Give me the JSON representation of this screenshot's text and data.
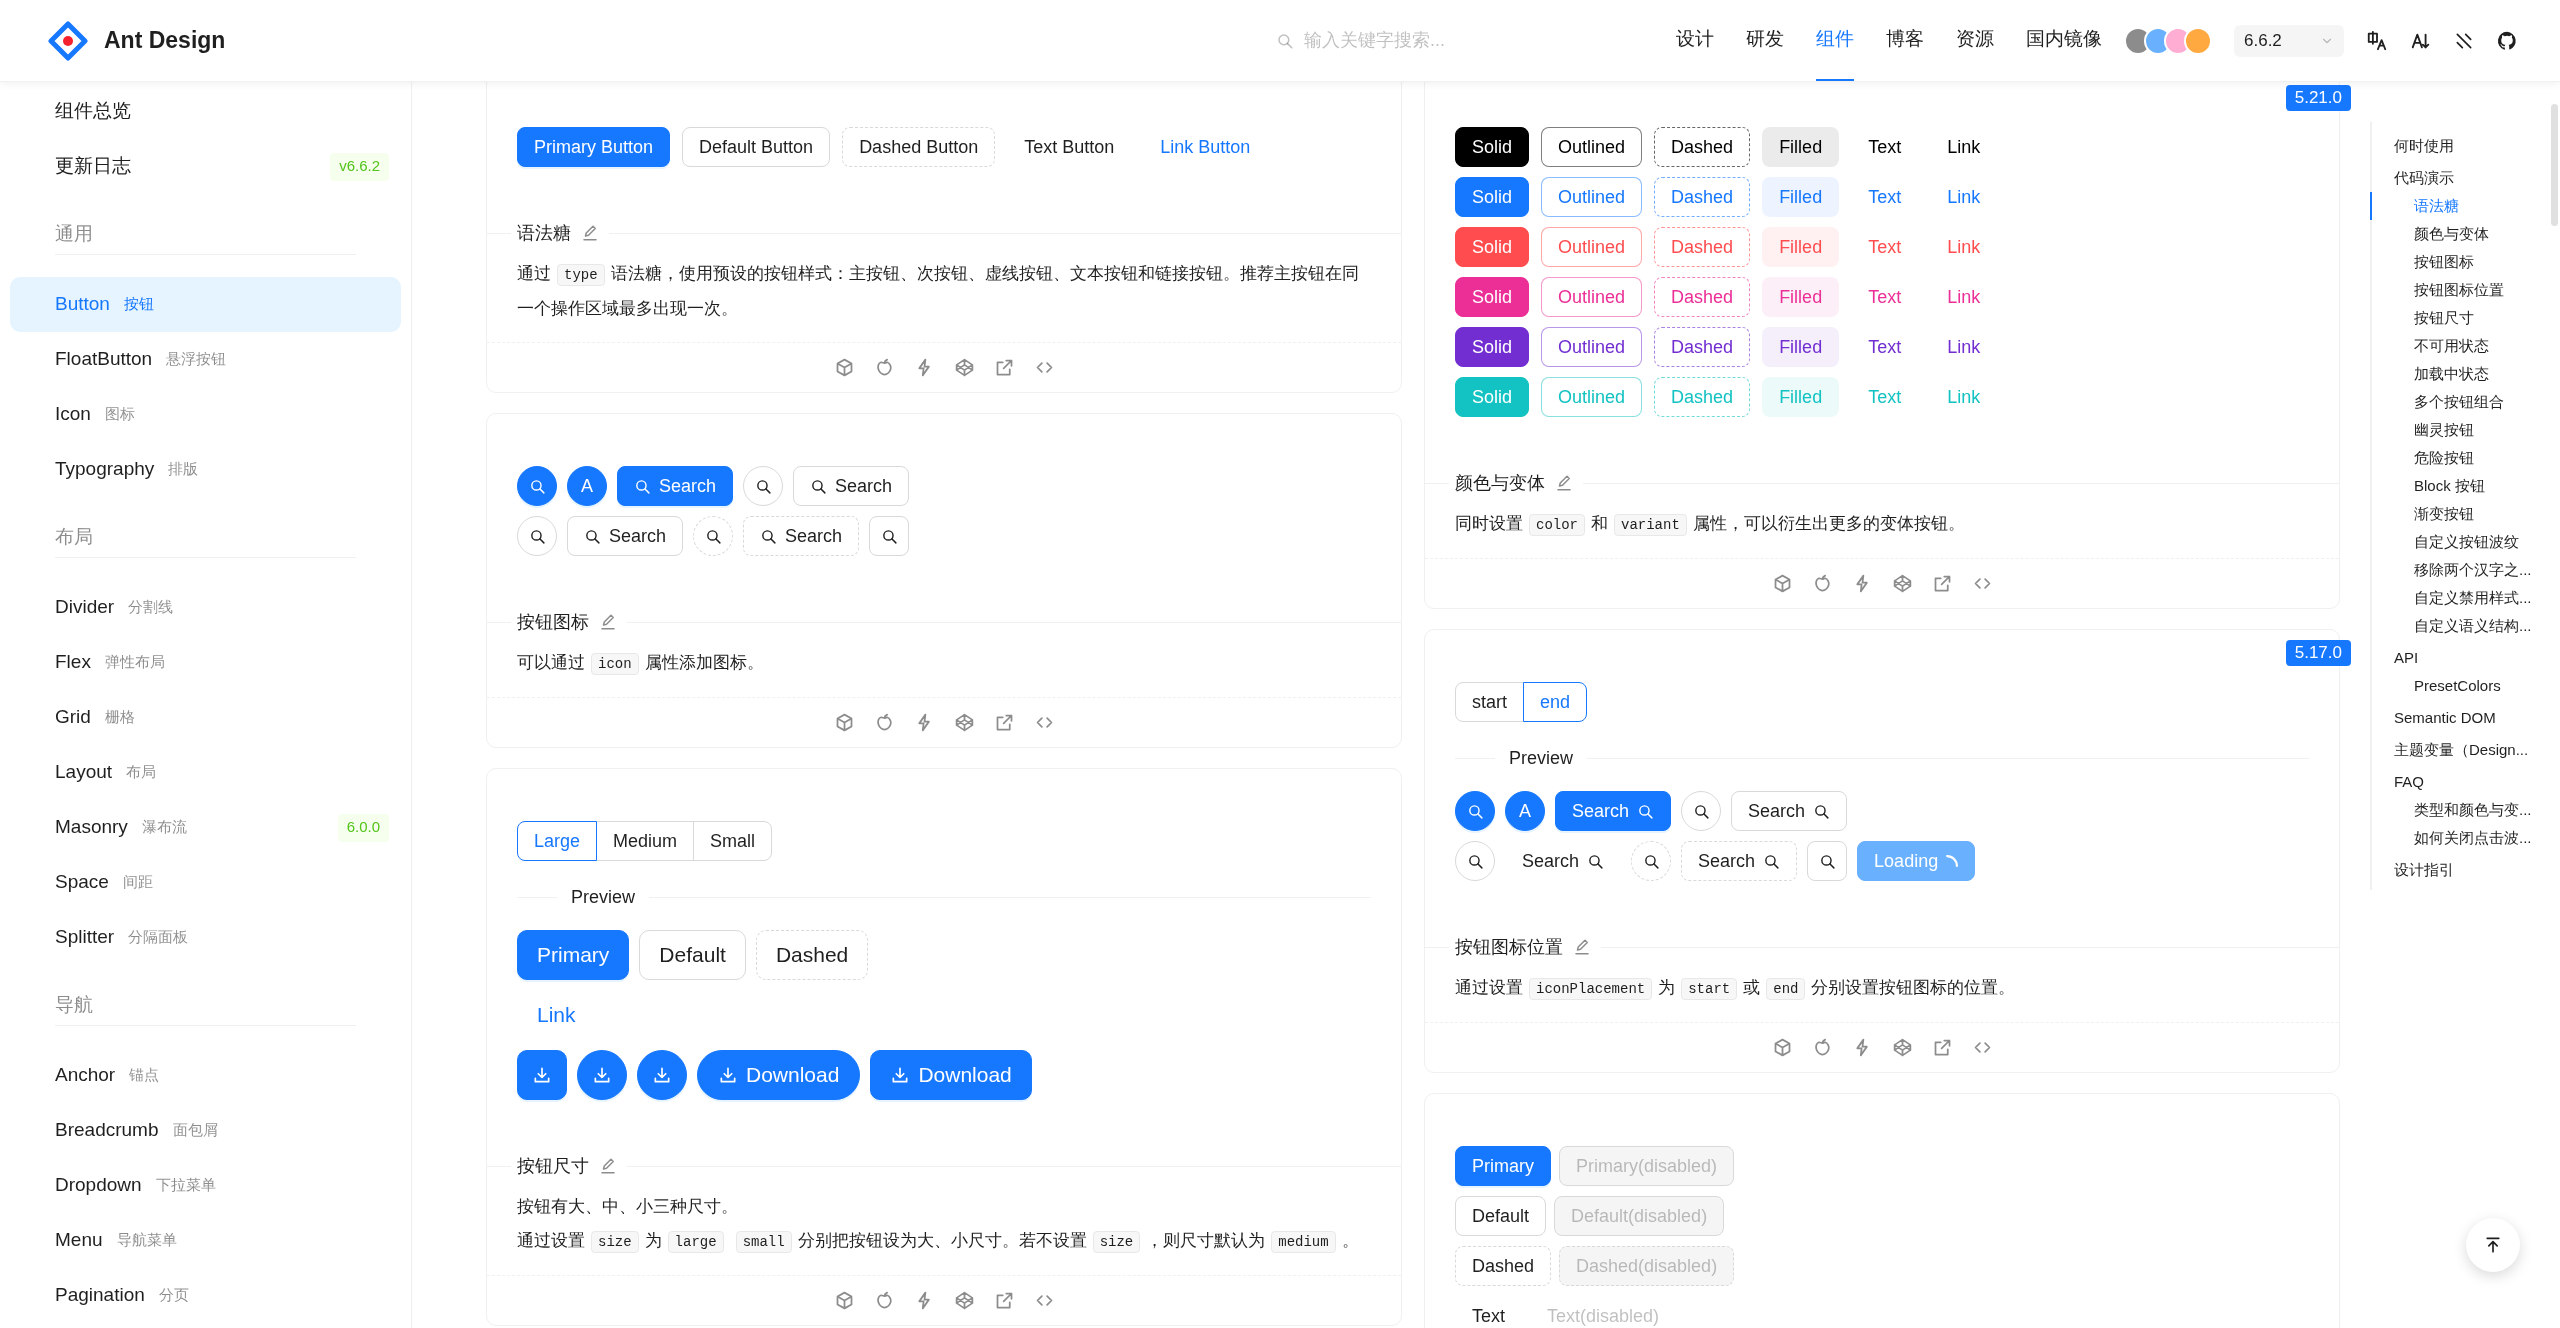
{
  "header": {
    "site_name": "Ant Design",
    "search": {
      "placeholder": "输入关键字搜索..."
    },
    "nav": [
      {
        "label": "设计",
        "selected": false
      },
      {
        "label": "研发",
        "selected": false
      },
      {
        "label": "组件",
        "selected": true
      },
      {
        "label": "博客",
        "selected": false
      },
      {
        "label": "资源",
        "selected": false
      },
      {
        "label": "国内镜像",
        "selected": false
      }
    ],
    "version": "6.6.2"
  },
  "sidebar": {
    "items": [
      {
        "label": "组件总览",
        "selected": false
      },
      {
        "label": "更新日志",
        "badge": "v6.6.2",
        "selected": false
      }
    ],
    "groups": [
      {
        "title": "通用",
        "items": [
          {
            "label": "Button",
            "subtitle": "按钮",
            "selected": true
          },
          {
            "label": "FloatButton",
            "subtitle": "悬浮按钮",
            "selected": false
          },
          {
            "label": "Icon",
            "subtitle": "图标",
            "selected": false
          },
          {
            "label": "Typography",
            "subtitle": "排版",
            "selected": false
          }
        ]
      },
      {
        "title": "布局",
        "items": [
          {
            "label": "Divider",
            "subtitle": "分割线",
            "selected": false
          },
          {
            "label": "Flex",
            "subtitle": "弹性布局",
            "selected": false
          },
          {
            "label": "Grid",
            "subtitle": "栅格",
            "selected": false
          },
          {
            "label": "Layout",
            "subtitle": "布局",
            "selected": false
          },
          {
            "label": "Masonry",
            "subtitle": "瀑布流",
            "badge": "6.0.0",
            "selected": false
          },
          {
            "label": "Space",
            "subtitle": "间距",
            "selected": false
          },
          {
            "label": "Splitter",
            "subtitle": "分隔面板",
            "selected": false
          }
        ]
      },
      {
        "title": "导航",
        "items": [
          {
            "label": "Anchor",
            "subtitle": "锚点",
            "selected": false
          },
          {
            "label": "Breadcrumb",
            "subtitle": "面包屑",
            "selected": false
          },
          {
            "label": "Dropdown",
            "subtitle": "下拉菜单",
            "selected": false
          },
          {
            "label": "Menu",
            "subtitle": "导航菜单",
            "selected": false
          },
          {
            "label": "Pagination",
            "subtitle": "分页",
            "selected": false
          }
        ]
      }
    ]
  },
  "columns": [
    [
      {
        "kind": "syntax",
        "buttons": [
          {
            "kind": "primary",
            "label": "Primary Button"
          },
          {
            "kind": "default",
            "label": "Default Button"
          },
          {
            "kind": "dashed",
            "label": "Dashed Button"
          },
          {
            "kind": "text",
            "label": "Text Button"
          },
          {
            "kind": "link",
            "label": "Link Button"
          }
        ],
        "title": "语法糖",
        "paragraphs": [
          [
            {
              "kind": "text",
              "text": "通过"
            },
            {
              "kind": "code",
              "text": "type"
            },
            {
              "kind": "text",
              "text": "语法糖，使用预设的按钮样式：主按钮、次按钮、虚线按钮、文本按钮和链接按钮。推荐主按钮在同一个操作区域最多出现一次。"
            }
          ]
        ]
      },
      {
        "kind": "icons",
        "rows": [
          [
            {
              "kind": "primary-circle",
              "icon": true
            },
            {
              "kind": "primary-circle",
              "icon": false,
              "label": "A"
            },
            {
              "kind": "primary",
              "icon": true,
              "label": "Search"
            },
            {
              "kind": "default-circle",
              "icon": true
            },
            {
              "kind": "default",
              "icon": true,
              "label": "Search"
            }
          ],
          [
            {
              "kind": "default-circle",
              "icon": true
            },
            {
              "kind": "default",
              "icon": true,
              "label": "Search"
            },
            {
              "kind": "dashed-circle",
              "icon": true
            },
            {
              "kind": "dashed",
              "icon": true,
              "label": "Search"
            },
            {
              "kind": "default",
              "icon": true
            }
          ]
        ],
        "title": "按钮图标",
        "paragraphs": [
          [
            {
              "kind": "text",
              "text": "可以通过"
            },
            {
              "kind": "code",
              "text": "icon"
            },
            {
              "kind": "text",
              "text": "属性添加图标。"
            }
          ]
        ]
      },
      {
        "kind": "sizes",
        "options": [
          {
            "label": "Large",
            "selected": true
          },
          {
            "label": "Medium",
            "selected": false
          },
          {
            "label": "Small",
            "selected": false
          }
        ],
        "preview_label": "Preview",
        "rows": [
          [
            {
              "kind": "primary",
              "icon": false,
              "label": "Primary"
            },
            {
              "kind": "default",
              "icon": false,
              "label": "Default"
            },
            {
              "kind": "dashed",
              "icon": false,
              "label": "Dashed"
            }
          ],
          [
            {
              "kind": "link",
              "icon": false,
              "label": "Link"
            }
          ],
          [
            {
              "kind": "primary",
              "icon": true
            },
            {
              "kind": "primary-circle",
              "icon": true
            },
            {
              "kind": "primary-circle",
              "icon": true
            },
            {
              "kind": "primary-round",
              "icon": true,
              "label": "Download"
            },
            {
              "kind": "primary",
              "icon": true,
              "label": "Download"
            }
          ]
        ],
        "title": "按钮尺寸",
        "paragraphs": [
          [
            {
              "kind": "text",
              "text": "按钮有大、中、小三种尺寸。"
            }
          ],
          [
            {
              "kind": "text",
              "text": "通过设置"
            },
            {
              "kind": "code",
              "text": "size"
            },
            {
              "kind": "text",
              "text": "为"
            },
            {
              "kind": "code",
              "text": "large"
            },
            {
              "kind": "code",
              "text": "small"
            },
            {
              "kind": "text",
              "text": "分别把按钮设为大、小尺寸。若不设置"
            },
            {
              "kind": "code",
              "text": "size"
            },
            {
              "kind": "text",
              "text": "，则尺寸默认为"
            },
            {
              "kind": "code",
              "text": "medium"
            },
            {
              "kind": "text",
              "text": "。"
            }
          ]
        ]
      }
    ],
    [
      {
        "kind": "colors",
        "badge": "5.21.0",
        "rows": [
          {
            "color": "#000000",
            "buttons": [
              {
                "kind": "solid",
                "label": "Solid"
              },
              {
                "kind": "outlined",
                "label": "Outlined"
              },
              {
                "kind": "dashed",
                "label": "Dashed"
              },
              {
                "kind": "filled",
                "label": "Filled"
              },
              {
                "kind": "text",
                "label": "Text"
              },
              {
                "kind": "link",
                "label": "Link"
              }
            ]
          },
          {
            "color": "#1677ff",
            "buttons": [
              {
                "kind": "solid",
                "label": "Solid"
              },
              {
                "kind": "outlined",
                "label": "Outlined"
              },
              {
                "kind": "dashed",
                "label": "Dashed"
              },
              {
                "kind": "filled",
                "label": "Filled"
              },
              {
                "kind": "text",
                "label": "Text"
              },
              {
                "kind": "link",
                "label": "Link"
              }
            ]
          },
          {
            "color": "#ff4d4f",
            "buttons": [
              {
                "kind": "solid",
                "label": "Solid"
              },
              {
                "kind": "outlined",
                "label": "Outlined"
              },
              {
                "kind": "dashed",
                "label": "Dashed"
              },
              {
                "kind": "filled",
                "label": "Filled"
              },
              {
                "kind": "text",
                "label": "Text"
              },
              {
                "kind": "link",
                "label": "Link"
              }
            ]
          },
          {
            "color": "#eb2f96",
            "buttons": [
              {
                "kind": "solid",
                "label": "Solid"
              },
              {
                "kind": "outlined",
                "label": "Outlined"
              },
              {
                "kind": "dashed",
                "label": "Dashed"
              },
              {
                "kind": "filled",
                "label": "Filled"
              },
              {
                "kind": "text",
                "label": "Text"
              },
              {
                "kind": "link",
                "label": "Link"
              }
            ]
          },
          {
            "color": "#722ed1",
            "buttons": [
              {
                "kind": "solid",
                "label": "Solid"
              },
              {
                "kind": "outlined",
                "label": "Outlined"
              },
              {
                "kind": "dashed",
                "label": "Dashed"
              },
              {
                "kind": "filled",
                "label": "Filled"
              },
              {
                "kind": "text",
                "label": "Text"
              },
              {
                "kind": "link",
                "label": "Link"
              }
            ]
          },
          {
            "color": "#13c2c2",
            "buttons": [
              {
                "kind": "solid",
                "label": "Solid"
              },
              {
                "kind": "outlined",
                "label": "Outlined"
              },
              {
                "kind": "dashed",
                "label": "Dashed"
              },
              {
                "kind": "filled",
                "label": "Filled"
              },
              {
                "kind": "text",
                "label": "Text"
              },
              {
                "kind": "link",
                "label": "Link"
              }
            ]
          }
        ],
        "title": "颜色与变体",
        "paragraphs": [
          [
            {
              "kind": "text",
              "text": "同时设置"
            },
            {
              "kind": "code",
              "text": "color"
            },
            {
              "kind": "text",
              "text": "和"
            },
            {
              "kind": "code",
              "text": "variant"
            },
            {
              "kind": "text",
              "text": "属性，可以衍生出更多的变体按钮。"
            }
          ]
        ]
      },
      {
        "kind": "placement",
        "badge": "5.17.0",
        "options": [
          {
            "label": "start",
            "selected": false
          },
          {
            "label": "end",
            "selected": true
          }
        ],
        "preview_label": "Preview",
        "rows": [
          [
            {
              "kind": "primary-circle",
              "icon": true,
              "loading": false
            },
            {
              "kind": "primary-circle",
              "icon": false,
              "loading": false,
              "label": "A"
            },
            {
              "kind": "primary",
              "icon": true,
              "loading": false,
              "label": "Search"
            },
            {
              "kind": "default-circle",
              "icon": true,
              "loading": false
            },
            {
              "kind": "default",
              "icon": true,
              "loading": false,
              "label": "Search"
            }
          ],
          [
            {
              "kind": "default-circle",
              "icon": true,
              "loading": false
            },
            {
              "kind": "text",
              "icon": true,
              "loading": false,
              "label": "Search"
            },
            {
              "kind": "dashed-circle",
              "icon": true,
              "loading": false
            },
            {
              "kind": "dashed",
              "icon": true,
              "loading": false,
              "label": "Search"
            },
            {
              "kind": "default",
              "icon": true,
              "loading": false
            },
            {
              "kind": "primary",
              "icon": false,
              "loading": true,
              "label": "Loading"
            }
          ]
        ],
        "title": "按钮图标位置",
        "paragraphs": [
          [
            {
              "kind": "text",
              "text": "通过设置"
            },
            {
              "kind": "code",
              "text": "iconPlacement"
            },
            {
              "kind": "text",
              "text": "为"
            },
            {
              "kind": "code",
              "text": "start"
            },
            {
              "kind": "text",
              "text": "或"
            },
            {
              "kind": "code",
              "text": "end"
            },
            {
              "kind": "text",
              "text": "分别设置按钮图标的位置。"
            }
          ]
        ]
      },
      {
        "kind": "disabled",
        "rows": [
          [
            {
              "kind": "primary",
              "label": "Primary",
              "disabled": false
            },
            {
              "kind": "primary",
              "label": "Primary(disabled)",
              "disabled": true
            }
          ],
          [
            {
              "kind": "default",
              "label": "Default",
              "disabled": false
            },
            {
              "kind": "default",
              "label": "Default(disabled)",
              "disabled": true
            }
          ],
          [
            {
              "kind": "dashed",
              "label": "Dashed",
              "disabled": false
            },
            {
              "kind": "dashed",
              "label": "Dashed(disabled)",
              "disabled": true
            }
          ],
          [
            {
              "kind": "text",
              "label": "Text",
              "disabled": false
            },
            {
              "kind": "text",
              "label": "Text(disabled)",
              "disabled": true
            }
          ]
        ]
      }
    ]
  ],
  "toc": [
    {
      "label": "何时使用",
      "selected": false
    },
    {
      "label": "代码演示",
      "selected": false,
      "children": [
        {
          "label": "语法糖",
          "selected": true
        },
        {
          "label": "颜色与变体",
          "selected": false
        },
        {
          "label": "按钮图标",
          "selected": false
        },
        {
          "label": "按钮图标位置",
          "selected": false
        },
        {
          "label": "按钮尺寸",
          "selected": false
        },
        {
          "label": "不可用状态",
          "selected": false
        },
        {
          "label": "加载中状态",
          "selected": false
        },
        {
          "label": "多个按钮组合",
          "selected": false
        },
        {
          "label": "幽灵按钮",
          "selected": false
        },
        {
          "label": "危险按钮",
          "selected": false
        },
        {
          "label": "Block 按钮",
          "selected": false
        },
        {
          "label": "渐变按钮",
          "selected": false
        },
        {
          "label": "自定义按钮波纹",
          "selected": false
        },
        {
          "label": "移除两个汉字之...",
          "selected": false
        },
        {
          "label": "自定义禁用样式...",
          "selected": false
        },
        {
          "label": "自定义语义结构...",
          "selected": false
        }
      ]
    },
    {
      "label": "API",
      "selected": false,
      "children": [
        {
          "label": "PresetColors",
          "selected": false
        }
      ]
    },
    {
      "label": "Semantic DOM",
      "selected": false
    },
    {
      "label": "主题变量（Design...",
      "selected": false
    },
    {
      "label": "FAQ",
      "selected": false,
      "children": [
        {
          "label": "类型和颜色与变...",
          "selected": false
        },
        {
          "label": "如何关闭点击波...",
          "selected": false
        }
      ]
    },
    {
      "label": "设计指引",
      "selected": false
    }
  ]
}
